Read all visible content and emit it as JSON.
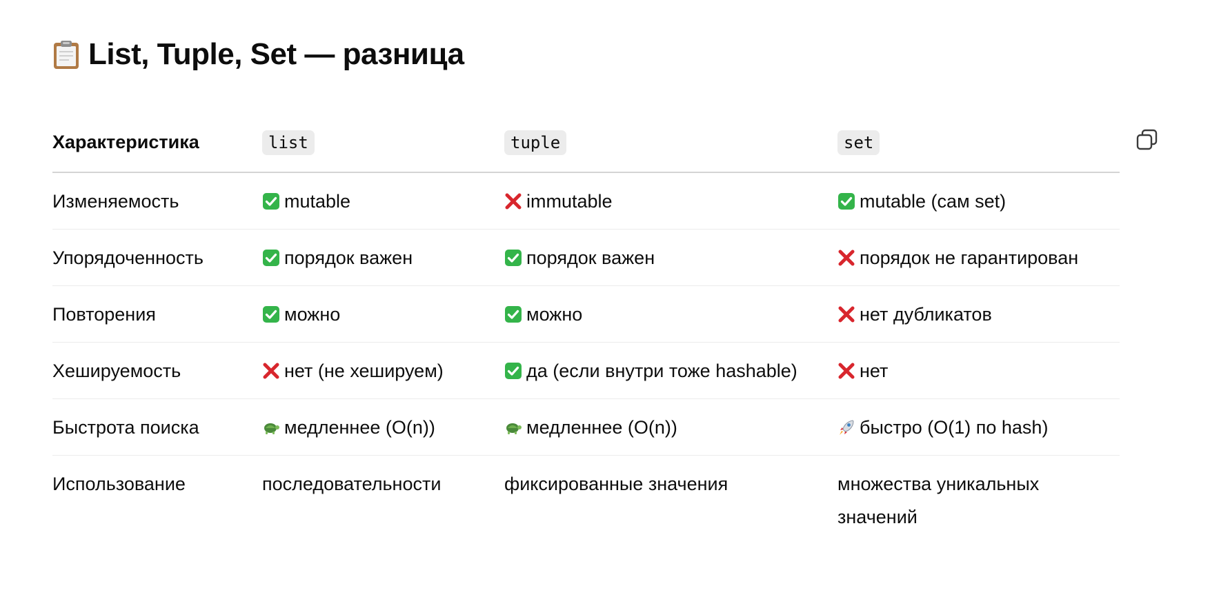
{
  "heading": {
    "icon": "clipboard-icon",
    "title": "List, Tuple, Set — разница"
  },
  "toolbar": {
    "copy_icon": "copy-icon"
  },
  "table": {
    "headers": [
      "Характеристика",
      "list",
      "tuple",
      "set"
    ],
    "rows": [
      {
        "label": "Изменяемость",
        "cells": [
          {
            "icon": "check-icon",
            "text": "mutable"
          },
          {
            "icon": "cross-icon",
            "text": "immutable"
          },
          {
            "icon": "check-icon",
            "text": "mutable (сам set)"
          }
        ]
      },
      {
        "label": "Упорядоченность",
        "cells": [
          {
            "icon": "check-icon",
            "text": "порядок важен"
          },
          {
            "icon": "check-icon",
            "text": "порядок важен"
          },
          {
            "icon": "cross-icon",
            "text": "порядок не гарантирован"
          }
        ]
      },
      {
        "label": "Повторения",
        "cells": [
          {
            "icon": "check-icon",
            "text": "можно"
          },
          {
            "icon": "check-icon",
            "text": "можно"
          },
          {
            "icon": "cross-icon",
            "text": "нет дубликатов"
          }
        ]
      },
      {
        "label": "Хешируемость",
        "cells": [
          {
            "icon": "cross-icon",
            "text": "нет (не хешируем)"
          },
          {
            "icon": "check-icon",
            "text": "да (если внутри тоже hashable)"
          },
          {
            "icon": "cross-icon",
            "text": "нет"
          }
        ]
      },
      {
        "label": "Быстрота поиска",
        "cells": [
          {
            "icon": "turtle-icon",
            "text": "медленнее (O(n))"
          },
          {
            "icon": "turtle-icon",
            "text": "медленнее (O(n))"
          },
          {
            "icon": "rocket-icon",
            "text": "быстро (O(1) по hash)"
          }
        ]
      },
      {
        "label": "Использование",
        "cells": [
          {
            "icon": "",
            "text": "последовательности"
          },
          {
            "icon": "",
            "text": "фиксированные значения"
          },
          {
            "icon": "",
            "text": "множества уникальных значений"
          }
        ]
      }
    ]
  },
  "colors": {
    "check": "#34b44a",
    "cross": "#d8262d",
    "code_bg": "#ececec",
    "header_rule": "#d4d4d4",
    "row_rule": "#ececec",
    "text": "#0d0d0d"
  }
}
